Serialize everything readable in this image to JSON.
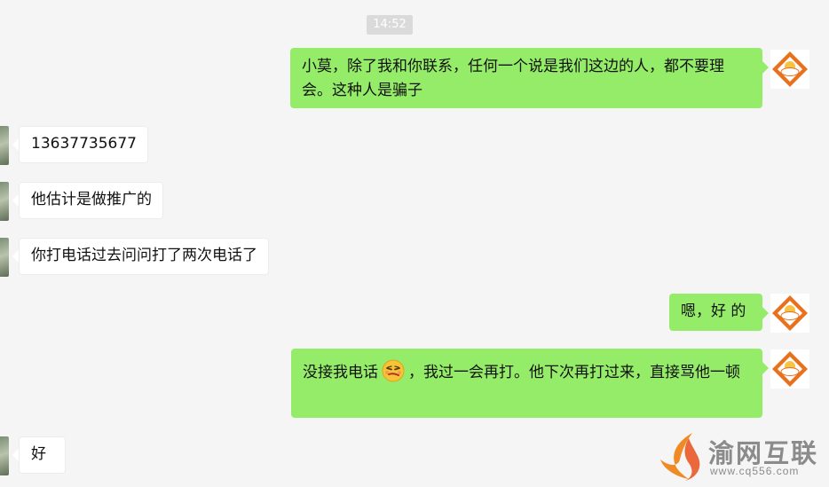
{
  "chat": {
    "timestamp": "14:52",
    "messages": [
      {
        "side": "out",
        "text": "小莫，除了我和你联系，任何一个说是我们这边的人，都不要理会。这种人是骗子"
      },
      {
        "side": "in",
        "text": "13637735677"
      },
      {
        "side": "in",
        "text": "他估计是做推广的"
      },
      {
        "side": "in",
        "text": "你打电话过去问问打了两次电话了"
      },
      {
        "side": "out",
        "text": "嗯，好 的"
      },
      {
        "side": "out",
        "text_before_emoji": "没接我电话",
        "emoji": "smirk-face-emoji",
        "text_after_emoji": "，我过一会再打。他下次再打过来，直接骂他一顿"
      },
      {
        "side": "in",
        "text": "好"
      }
    ]
  },
  "avatars": {
    "self_icon": "sun-cloud-diamond-icon",
    "self_colors": {
      "diamond": "#e8711e",
      "sun": "#f6c343",
      "cloud": "#ffffff"
    },
    "other_icon": "photo-avatar"
  },
  "watermark": {
    "title": "渝网互联",
    "url": "www.cq556.com",
    "logo_icon": "flame-swoosh-icon",
    "logo_colors": [
      "#f08a24",
      "#e94e1b"
    ]
  },
  "colors": {
    "background": "#f5f5f5",
    "outgoing_bubble": "#95ec69",
    "incoming_bubble": "#ffffff",
    "timestamp_badge": "#dadada"
  }
}
